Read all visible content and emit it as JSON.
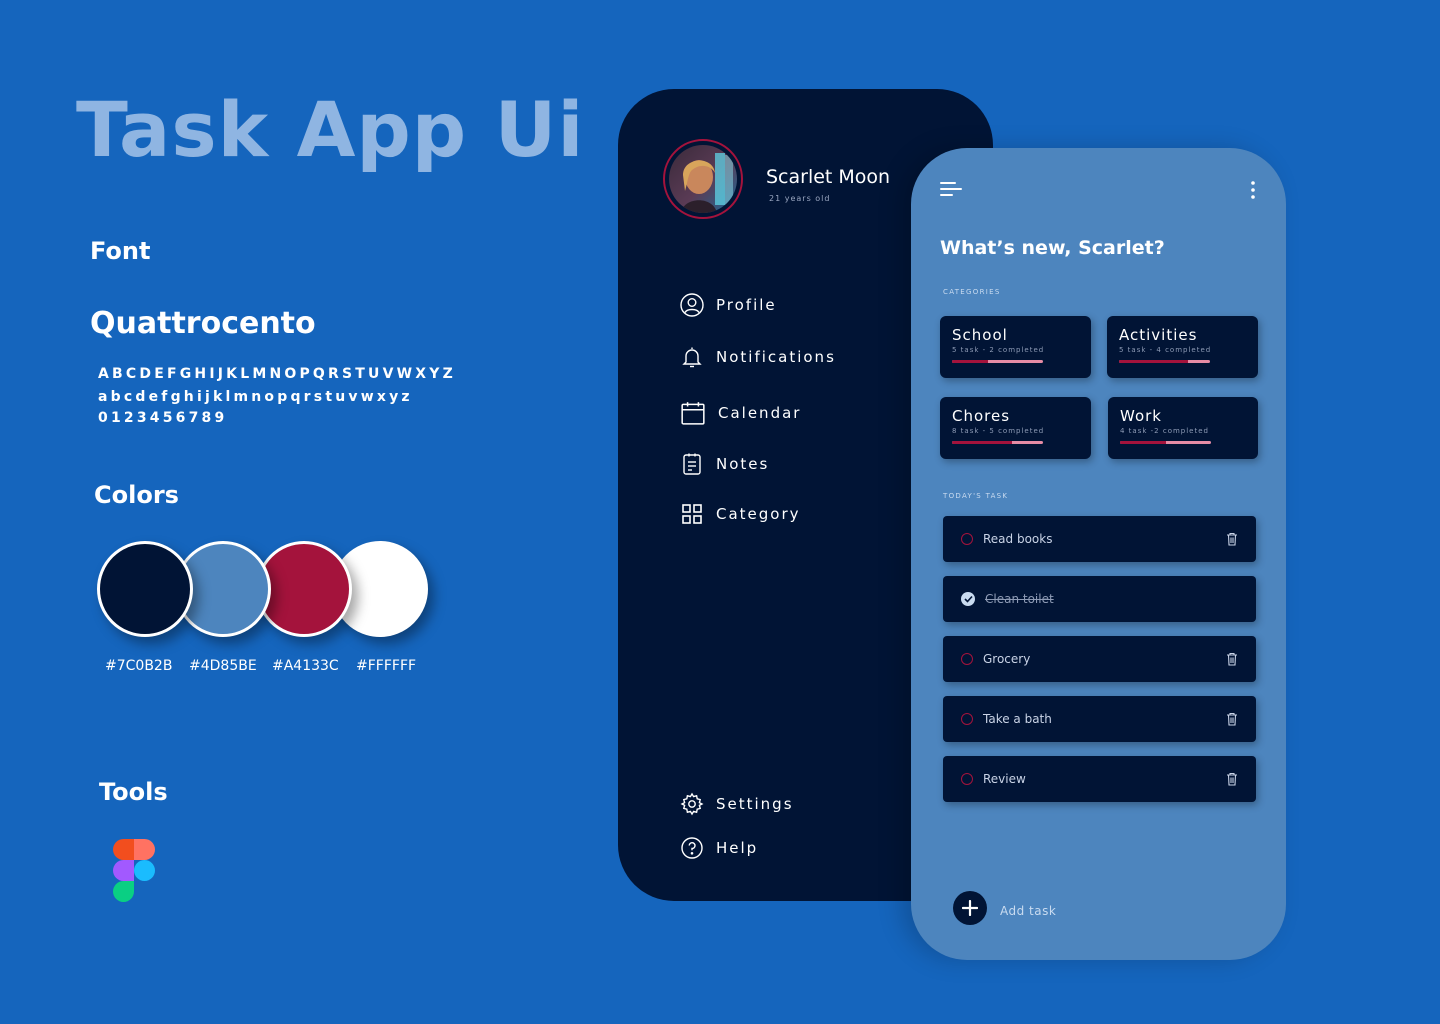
{
  "showcase": {
    "title": "Task App Ui",
    "font_heading": "Font",
    "font_name": "Quattrocento",
    "alphabet_upper": "ABCDEFGHIJKLMNOPQRSTUVWXYZ",
    "alphabet_lower": "abcdefghijklmnopqrstuvwxyz",
    "digits": "0123456789",
    "colors_heading": "Colors",
    "colors": [
      {
        "hex": "#7C0B2B",
        "swatch": "#011435"
      },
      {
        "hex": "#4D85BE",
        "swatch": "#4D85BE"
      },
      {
        "hex": "#A4133C",
        "swatch": "#A4133C"
      },
      {
        "hex": "#FFFFFF",
        "swatch": "#FFFFFF"
      }
    ],
    "tools_heading": "Tools",
    "tool_icon": "figma-logo-icon"
  },
  "drawer": {
    "user_name": "Scarlet Moon",
    "user_age": "21 years old",
    "menu": [
      {
        "label": "Profile",
        "icon": "user-circle-icon"
      },
      {
        "label": "Notifications",
        "icon": "bell-icon"
      },
      {
        "label": "Calendar",
        "icon": "calendar-icon"
      },
      {
        "label": "Notes",
        "icon": "notes-icon"
      },
      {
        "label": "Category",
        "icon": "grid-icon"
      }
    ],
    "bottom_menu": [
      {
        "label": "Settings",
        "icon": "gear-icon"
      },
      {
        "label": "Help",
        "icon": "help-circle-icon"
      }
    ]
  },
  "home": {
    "greeting": "What’s new, Scarlet?",
    "categories_label": "CATEGORIES",
    "categories": [
      {
        "title": "School",
        "subtitle": "5 task - 2 completed",
        "progress": 0.4
      },
      {
        "title": "Activities",
        "subtitle": "5 task - 4 completed",
        "progress": 0.76
      },
      {
        "title": "Chores",
        "subtitle": "8 task - 5 completed",
        "progress": 0.66
      },
      {
        "title": "Work",
        "subtitle": "4 task -2 completed",
        "progress": 0.5
      }
    ],
    "today_label": "TODAY'S TASK",
    "tasks": [
      {
        "label": "Read books",
        "done": false
      },
      {
        "label": "Clean toilet",
        "done": true
      },
      {
        "label": "Grocery",
        "done": false
      },
      {
        "label": "Take a bath",
        "done": false
      },
      {
        "label": "Review",
        "done": false
      }
    ],
    "add_task_label": "Add task"
  },
  "theme": {
    "background": "#1565BD",
    "navy": "#011435",
    "blue": "#4D85BE",
    "crimson": "#A4133C",
    "white": "#FFFFFF"
  }
}
